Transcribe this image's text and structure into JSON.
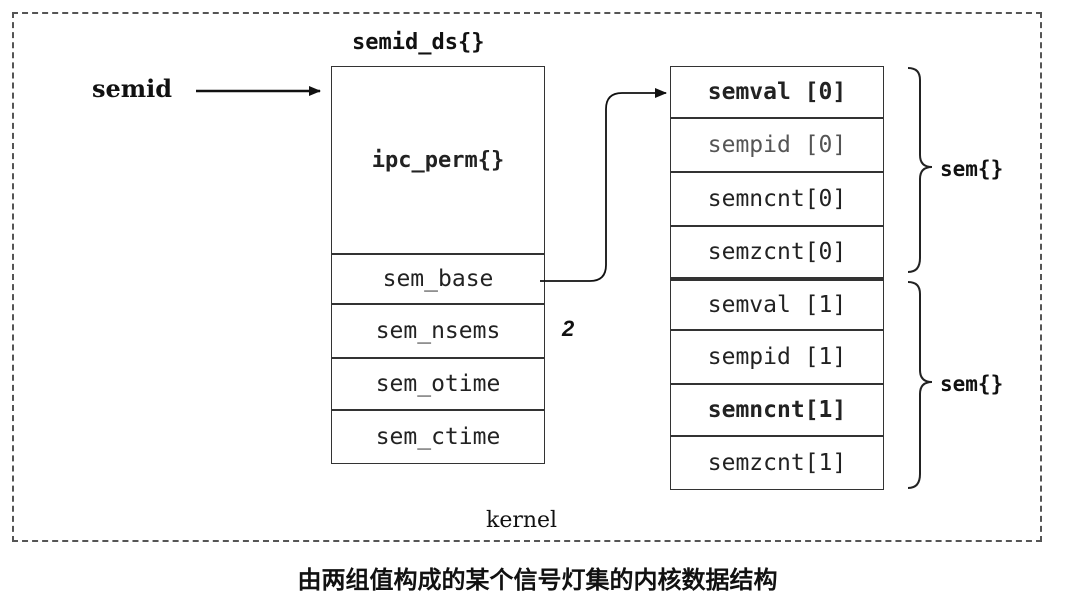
{
  "semid_ds": {
    "title": "semid_ds{}",
    "input_label": "semid",
    "ipc_perm": "ipc_perm{}",
    "fields": [
      "sem_base",
      "sem_nsems",
      "sem_otime",
      "sem_ctime"
    ],
    "nsems_value": "2"
  },
  "sem_array": {
    "groups": [
      {
        "label": "sem{}",
        "items": [
          "semval [0]",
          "sempid [0]",
          "semncnt[0]",
          "semzcnt[0]"
        ]
      },
      {
        "label": "sem{}",
        "items": [
          "semval [1]",
          "sempid [1]",
          "semncnt[1]",
          "semzcnt[1]"
        ]
      }
    ]
  },
  "kernel_label": "kernel",
  "caption": "由两组值构成的某个信号灯集的内核数据结构"
}
